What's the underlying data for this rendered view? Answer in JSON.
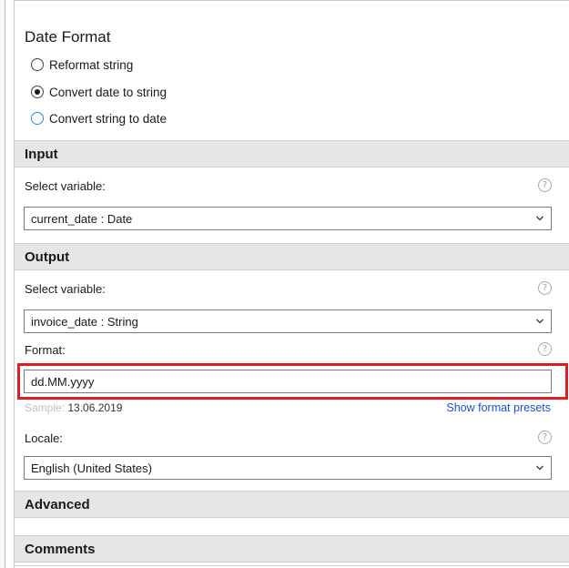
{
  "panel": {
    "title": "Date Format",
    "radios": [
      {
        "label": "Reformat string",
        "checked": false
      },
      {
        "label": "Convert date to string",
        "checked": true
      },
      {
        "label": "Convert string to date",
        "checked": false
      }
    ]
  },
  "input_section": {
    "header": "Input",
    "select_label": "Select variable:",
    "help_glyph": "?",
    "selected_value": "current_date : Date"
  },
  "output_section": {
    "header": "Output",
    "select_label": "Select variable:",
    "help_glyph": "?",
    "selected_value": "invoice_date : String",
    "format_label": "Format:",
    "format_value": "dd.MM.yyyy",
    "sample_label": "Sample:",
    "sample_value": "13.06.2019",
    "presets_link": "Show format presets",
    "locale_label": "Locale:",
    "locale_value": "English (United States)"
  },
  "advanced_section": {
    "header": "Advanced"
  },
  "comments_section": {
    "header": "Comments"
  },
  "colors": {
    "highlight": "#e01c24",
    "link": "#1a4fd6",
    "section_bg": "#e6e6e6"
  }
}
